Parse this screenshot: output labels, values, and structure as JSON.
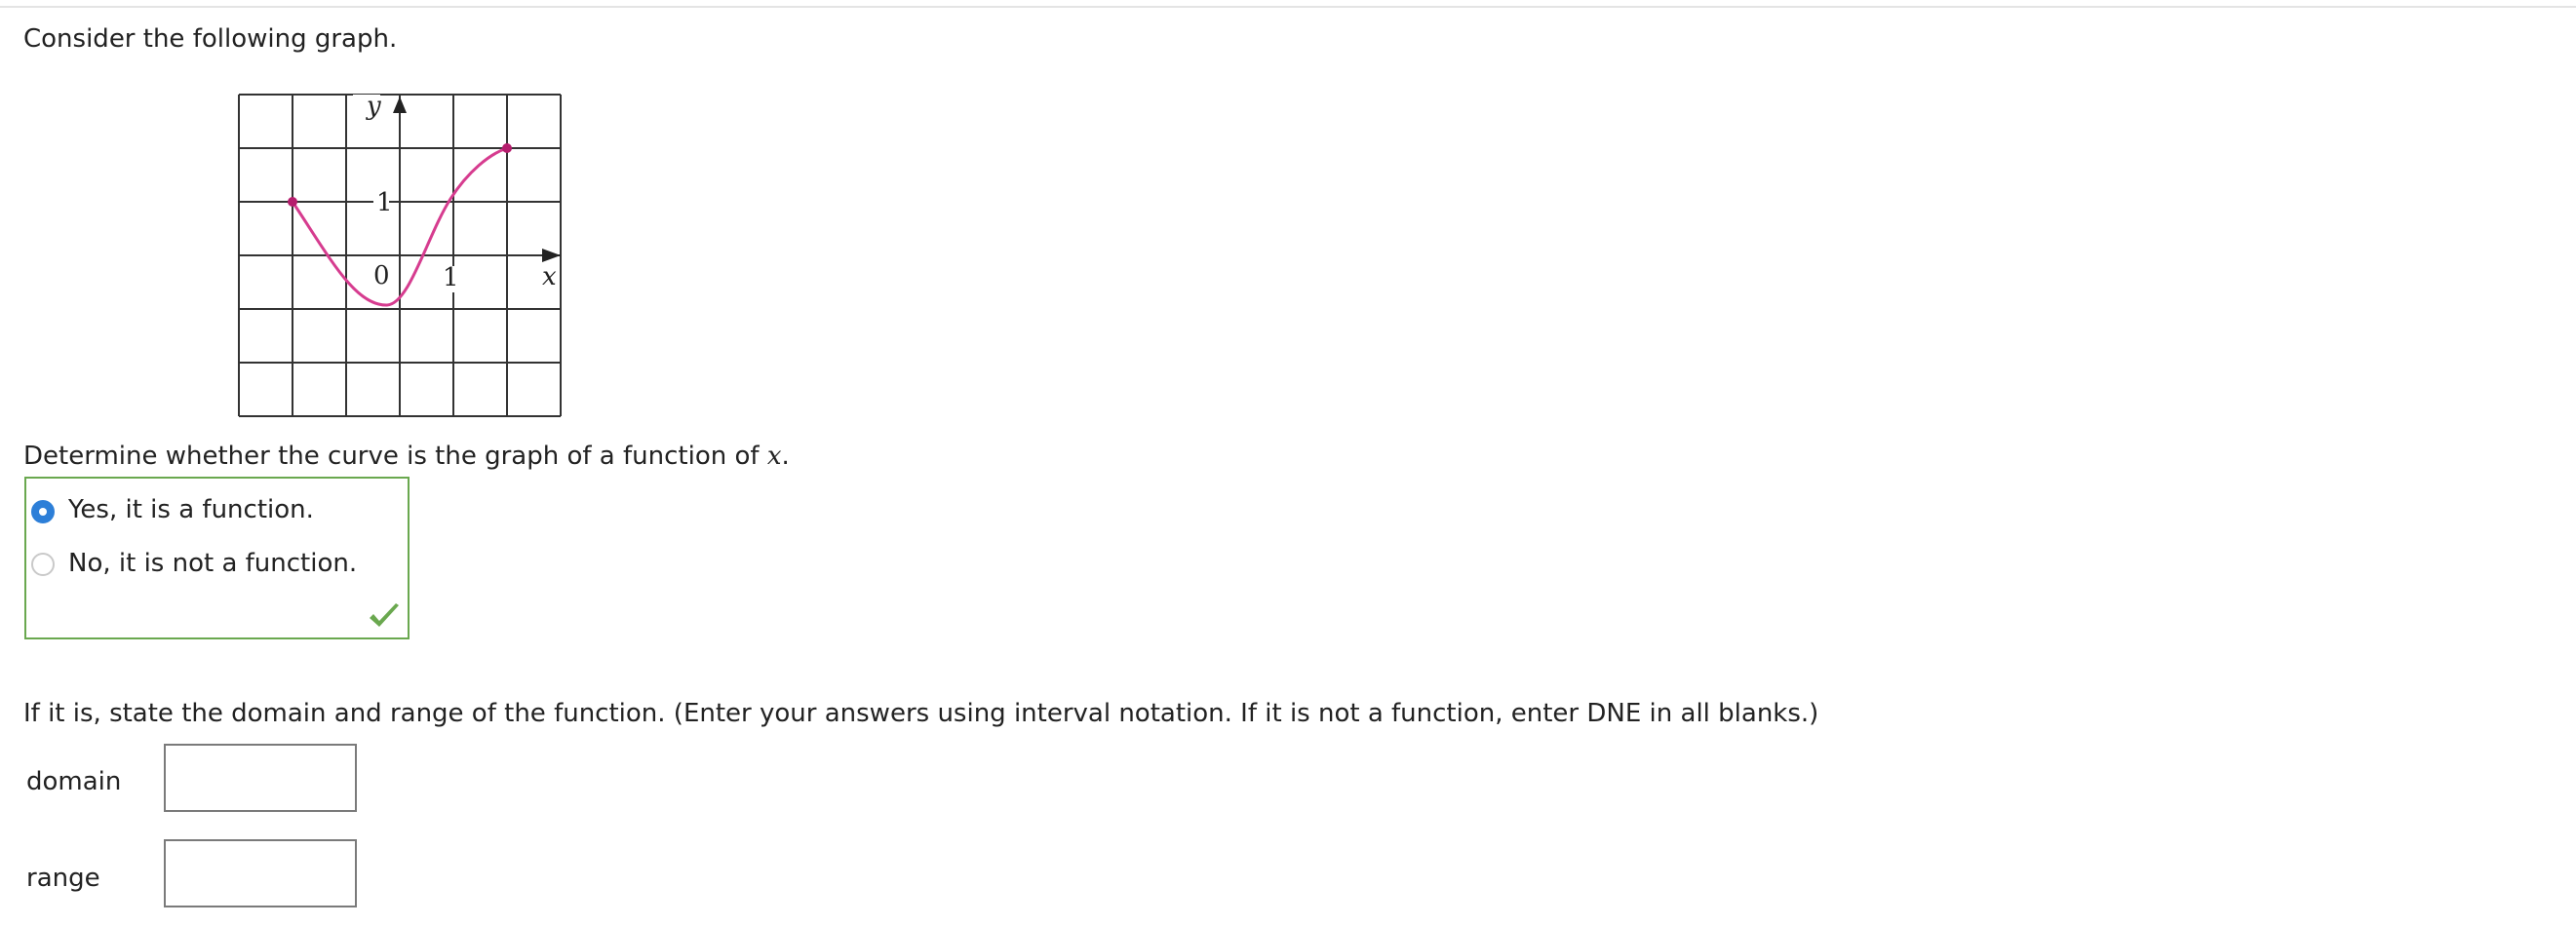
{
  "question": {
    "intro": "Consider the following graph.",
    "determine_prefix": "Determine whether the curve is the graph of a function of ",
    "determine_var": "x",
    "determine_suffix": ".",
    "domain_range_instruction": "If it is, state the domain and range of the function. (Enter your answers using interval notation. If it is not a function, enter DNE in all blanks.)"
  },
  "graph": {
    "y_axis_label": "y",
    "x_axis_label": "x",
    "tick_y": "1",
    "tick_x": "1",
    "origin_label": "0",
    "curve_color": "#d63c8f",
    "grid_color": "#333333"
  },
  "choices": [
    {
      "label": "Yes, it is a function.",
      "selected": true
    },
    {
      "label": "No, it is not a function.",
      "selected": false
    }
  ],
  "feedback": {
    "icon": "checkmark-icon",
    "color": "#6aa84f"
  },
  "fields": {
    "domain_label": "domain",
    "domain_value": "",
    "range_label": "range",
    "range_value": ""
  },
  "colors": {
    "radio_selected": "#2d7fd8",
    "answer_box_border": "#6aa84f"
  }
}
